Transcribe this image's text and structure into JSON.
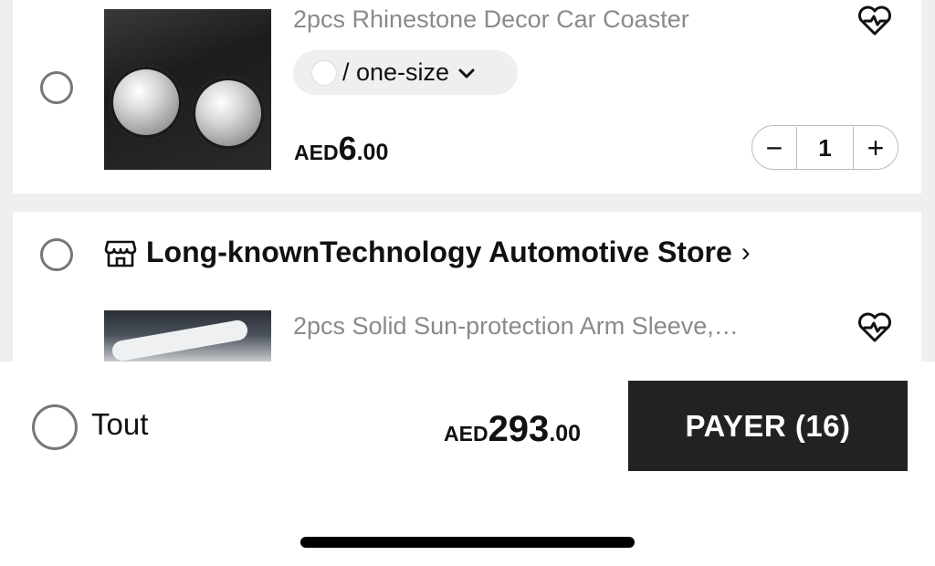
{
  "items": [
    {
      "title": "2pcs Rhinestone Decor Car Coaster",
      "variant": "/ one-size",
      "price": {
        "currency": "AED",
        "integer": "6",
        "decimal": ".00"
      },
      "quantity": "1",
      "selected": false
    },
    {
      "title": "2pcs Solid Sun-protection Arm Sleeve,…",
      "selected": false
    }
  ],
  "store": {
    "name": "Long-knownTechnology Automotive Store",
    "chevron": "›"
  },
  "quantity_controls": {
    "minus": "−",
    "plus": "+"
  },
  "icons": {
    "wishlist": "heart-plus-icon",
    "variant_dropdown": "chevron-down-icon",
    "store": "store-icon"
  },
  "footer": {
    "select_all_label": "Tout",
    "total": {
      "currency": "AED",
      "integer": "293",
      "decimal": ".00"
    },
    "checkout_label": "PAYER (16)"
  },
  "colors": {
    "checkout_button": "#222222",
    "background": "#efefef",
    "title_gray": "#8a8a8a"
  }
}
